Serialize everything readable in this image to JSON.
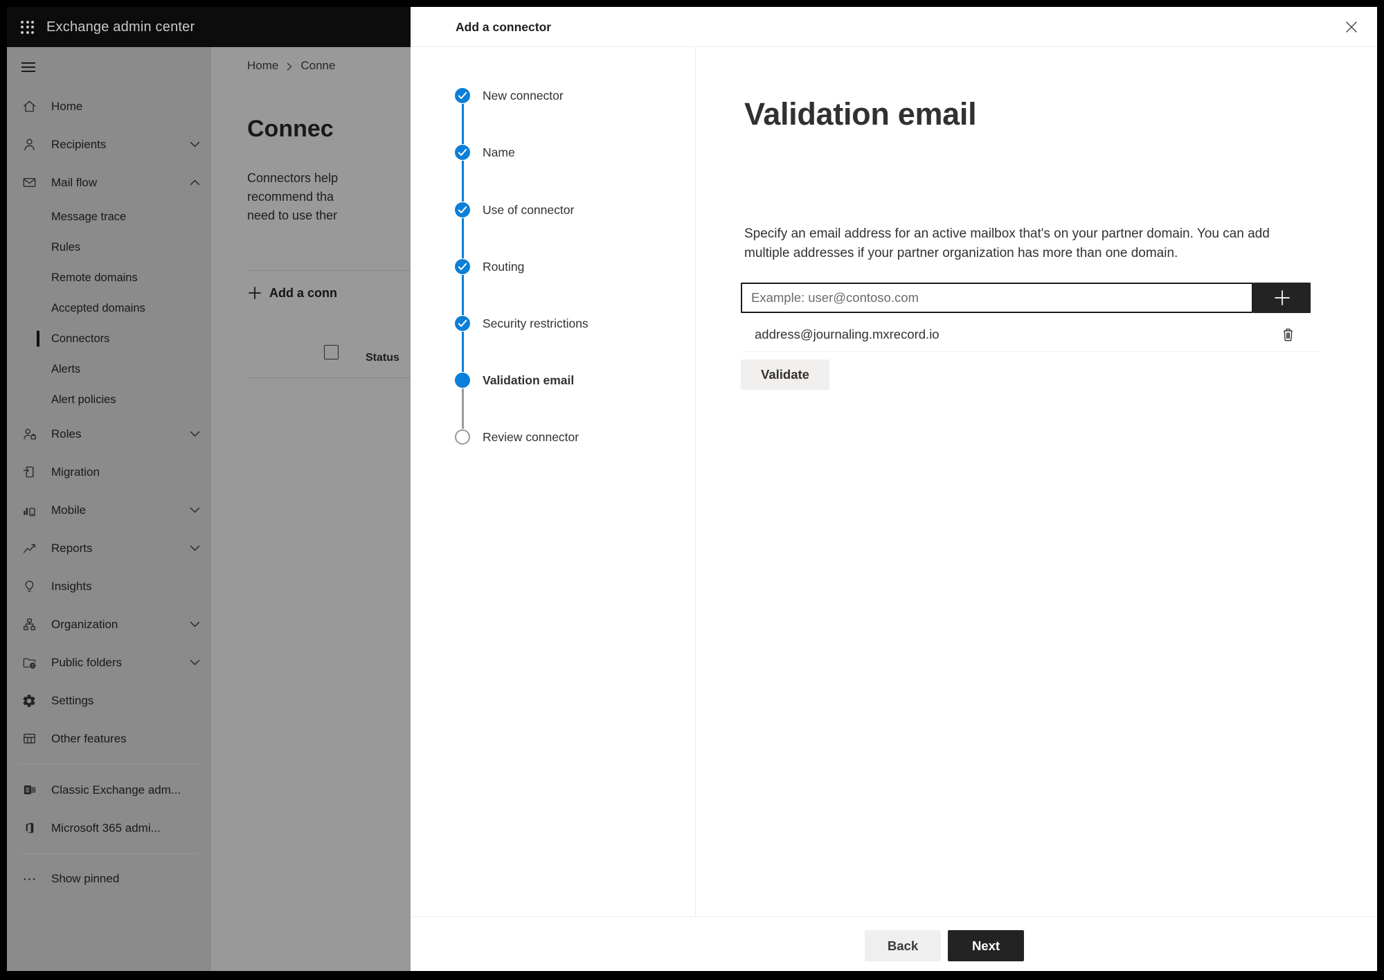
{
  "app": {
    "title": "Exchange admin center"
  },
  "sidebar": {
    "items": [
      {
        "label": "Home"
      },
      {
        "label": "Recipients"
      },
      {
        "label": "Mail flow"
      },
      {
        "label": "Message trace"
      },
      {
        "label": "Rules"
      },
      {
        "label": "Remote domains"
      },
      {
        "label": "Accepted domains"
      },
      {
        "label": "Connectors"
      },
      {
        "label": "Alerts"
      },
      {
        "label": "Alert policies"
      },
      {
        "label": "Roles"
      },
      {
        "label": "Migration"
      },
      {
        "label": "Mobile"
      },
      {
        "label": "Reports"
      },
      {
        "label": "Insights"
      },
      {
        "label": "Organization"
      },
      {
        "label": "Public folders"
      },
      {
        "label": "Settings"
      },
      {
        "label": "Other features"
      },
      {
        "label": "Classic Exchange adm..."
      },
      {
        "label": "Microsoft 365 admi..."
      },
      {
        "label": "Show pinned"
      }
    ]
  },
  "page": {
    "breadcrumb": {
      "home": "Home",
      "current": "Conne"
    },
    "heading": "Connec",
    "intro_lines": [
      "Connectors help",
      "recommend tha",
      "need to use ther"
    ],
    "add_connector_button": "Add a conn",
    "table": {
      "status_header": "Status"
    }
  },
  "dialog": {
    "title": "Add a connector",
    "steps": [
      {
        "label": "New connector",
        "state": "complete"
      },
      {
        "label": "Name",
        "state": "complete"
      },
      {
        "label": "Use of connector",
        "state": "complete"
      },
      {
        "label": "Routing",
        "state": "complete"
      },
      {
        "label": "Security restrictions",
        "state": "complete"
      },
      {
        "label": "Validation email",
        "state": "current"
      },
      {
        "label": "Review connector",
        "state": "upcoming"
      }
    ],
    "content": {
      "heading": "Validation email",
      "description_lines": [
        "Specify an email address for an active mailbox that's on your partner domain. You can add",
        "multiple addresses if your partner organization has more than one domain."
      ],
      "email_input": {
        "value": "",
        "placeholder": "Example: user@contoso.com"
      },
      "emails": [
        {
          "address": "address@journaling.mxrecord.io"
        }
      ],
      "validate_button": "Validate"
    },
    "footer": {
      "back_button": "Back",
      "next_button": "Next"
    }
  },
  "colors": {
    "accent_blue": "#0b7fd9",
    "topbar_black": "#0c0c0c",
    "dark_button": "#232323",
    "text_dark": "#323130",
    "divider": "#ededed"
  }
}
